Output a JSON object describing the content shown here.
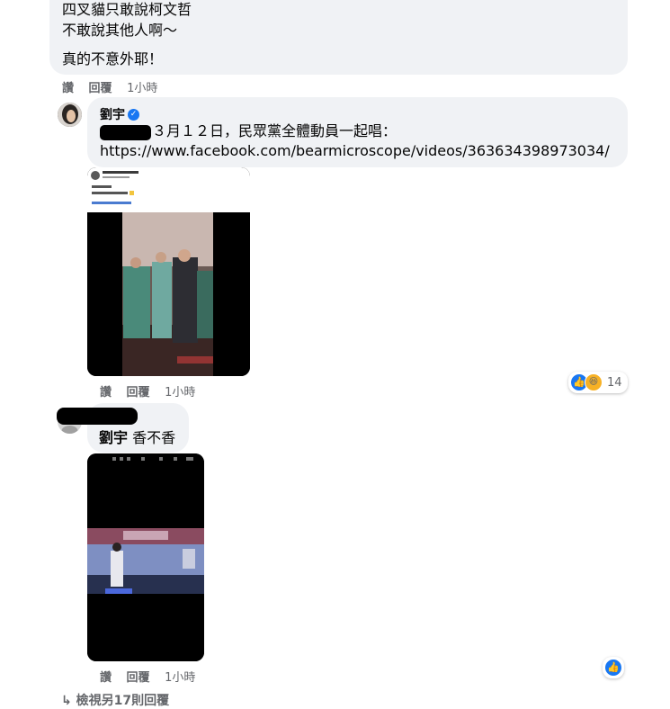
{
  "comment1": {
    "lines": [
      "四叉貓只敢說柯文哲",
      "不敢說其他人啊～",
      "真的不意外耶！"
    ],
    "actions": {
      "like": "讚",
      "reply": "回覆",
      "time": "1小時"
    }
  },
  "comment2": {
    "author": "劉宇",
    "verified": "✓",
    "text": "３月１２日，民眾黨全體動員一起唱：",
    "link": "https://www.facebook.com/bearmicroscope/videos/363634398973034/",
    "actions": {
      "like": "讚",
      "reply": "回覆",
      "time": "1小時"
    },
    "reactions": {
      "count": "14",
      "like_icon": "thumbs-up-icon",
      "haha_icon": "haha-icon"
    }
  },
  "comment3": {
    "mention": "劉宇",
    "text": "香不香",
    "actions": {
      "like": "讚",
      "reply": "回覆",
      "time": "1小時"
    },
    "reactions": {
      "like_icon": "thumbs-up-icon"
    }
  },
  "more_replies": {
    "arrow": "↳",
    "label": "檢視另17則回覆"
  },
  "colors": {
    "bubble": "#f0f2f5",
    "meta": "#65676b",
    "link": "#050505",
    "accent": "#1877f2"
  }
}
